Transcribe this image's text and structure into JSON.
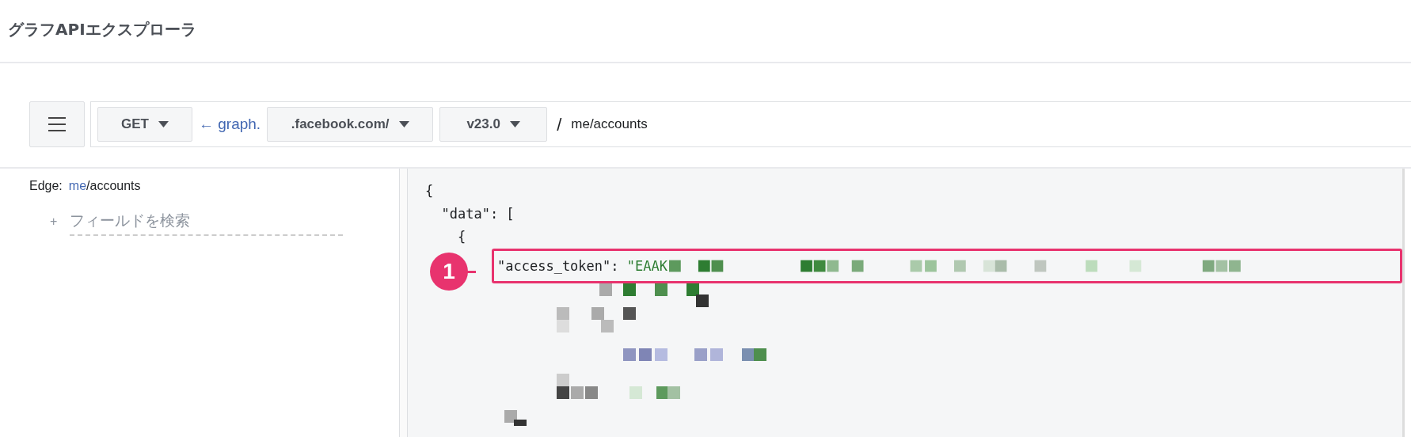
{
  "page_title": "グラフAPIエクスプローラ",
  "toolbar": {
    "method": {
      "label": "GET"
    },
    "host_prefix": "← graph.",
    "domain": {
      "label": ".facebook.com/"
    },
    "version": {
      "label": "v23.0"
    },
    "separator": "/",
    "path": "me/accounts"
  },
  "sidebar": {
    "edge_label": "Edge:",
    "edge_link": "me",
    "edge_rest": "/accounts",
    "search": {
      "placeholder": "フィールドを検索",
      "icon_text": "+"
    }
  },
  "code": {
    "lines": [
      {
        "text": "{"
      },
      {
        "text": "  \"data\": ["
      },
      {
        "text": "    {"
      },
      {
        "key": "\"access_token\"",
        "sep": ": ",
        "value": "\"EAAK",
        "highlighted": true
      }
    ]
  },
  "annotation": {
    "number": "1"
  }
}
